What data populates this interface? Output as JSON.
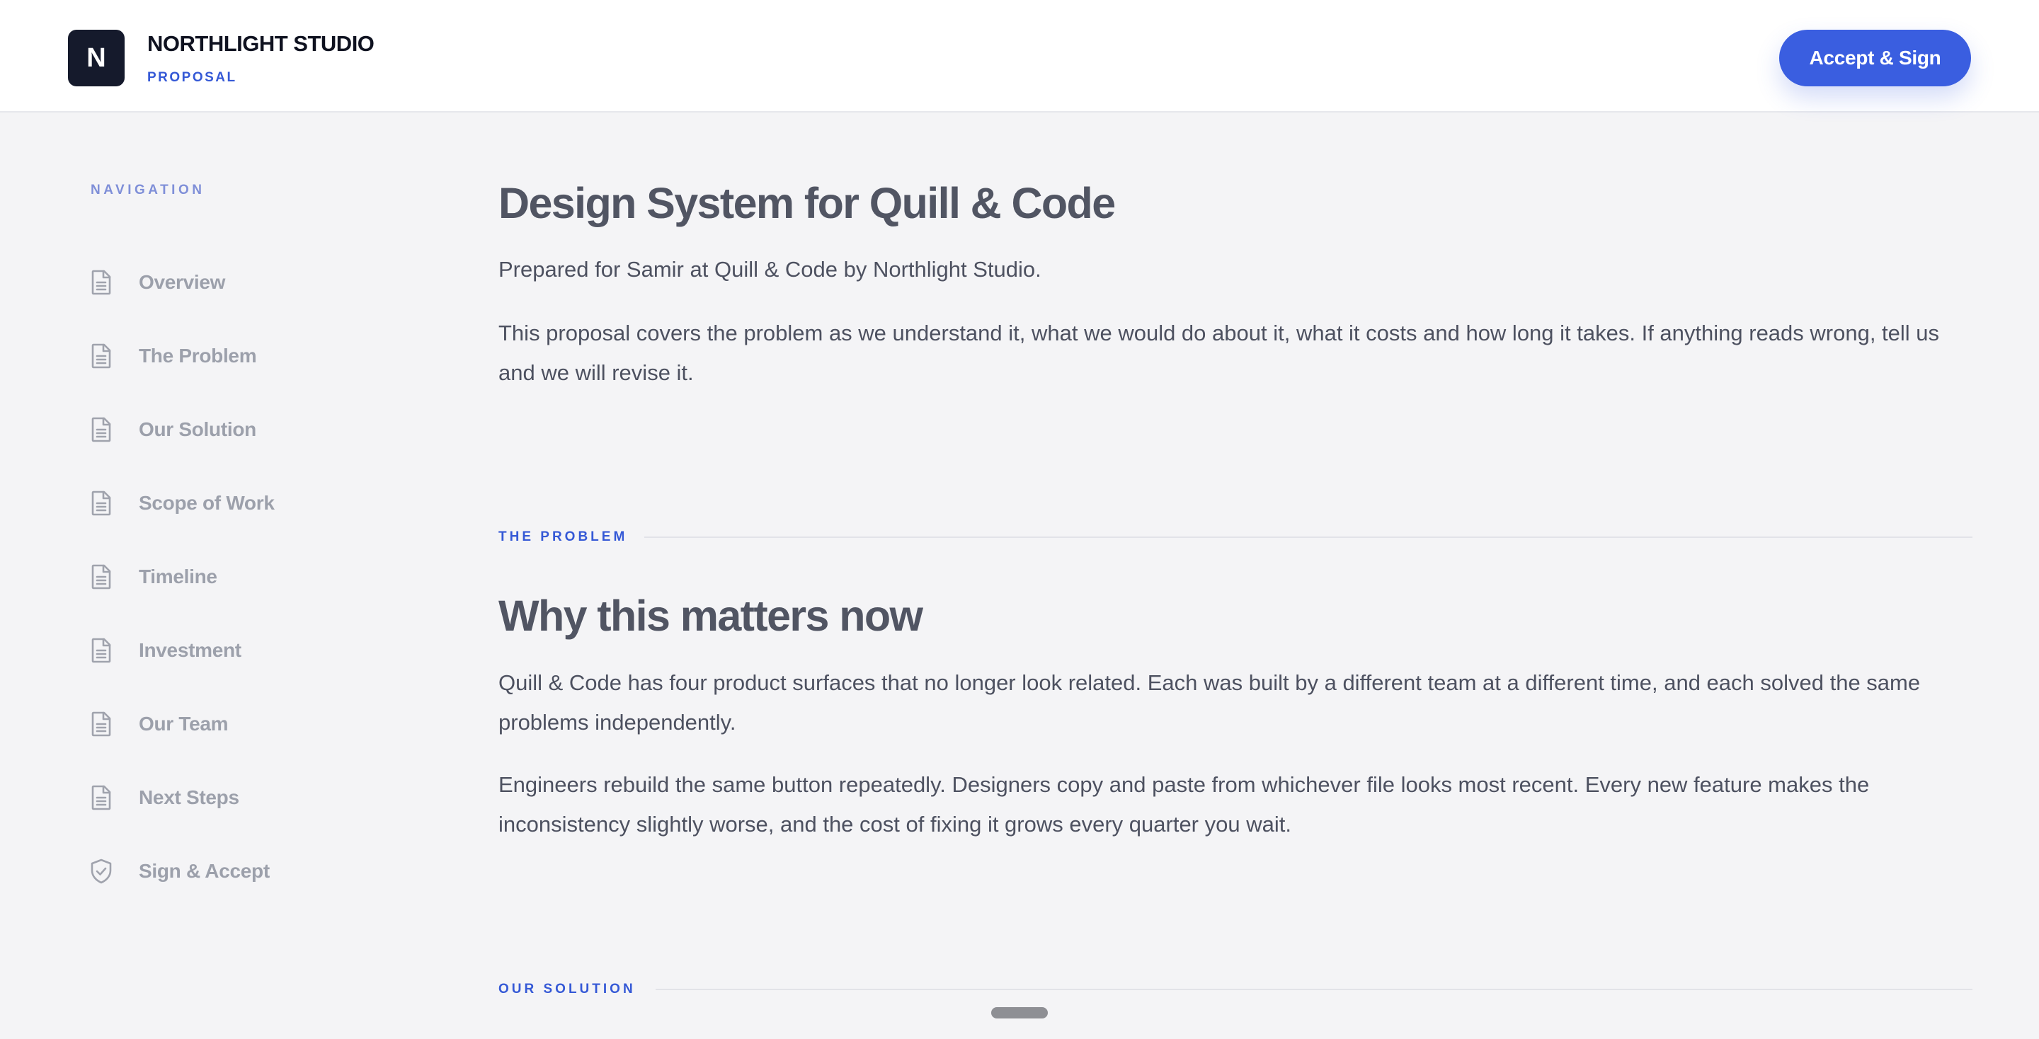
{
  "header": {
    "logo_letter": "N",
    "brand_name": "NORTHLIGHT STUDIO",
    "brand_subtitle": "PROPOSAL",
    "accept_button": "Accept & Sign"
  },
  "sidebar": {
    "heading": "NAVIGATION",
    "items": [
      {
        "label": "Overview",
        "icon": "document-icon"
      },
      {
        "label": "The Problem",
        "icon": "document-icon"
      },
      {
        "label": "Our Solution",
        "icon": "document-icon"
      },
      {
        "label": "Scope of Work",
        "icon": "document-icon"
      },
      {
        "label": "Timeline",
        "icon": "document-icon"
      },
      {
        "label": "Investment",
        "icon": "document-icon"
      },
      {
        "label": "Our Team",
        "icon": "document-icon"
      },
      {
        "label": "Next Steps",
        "icon": "document-icon"
      },
      {
        "label": "Sign & Accept",
        "icon": "shield-check-icon"
      }
    ]
  },
  "main": {
    "title": "Design System for Quill & Code",
    "prepared_for": "Prepared for Samir at Quill & Code by Northlight Studio.",
    "intro": "This proposal covers the problem as we understand it, what we would do about it, what it costs and how long it takes. If anything reads wrong, tell us and we will revise it.",
    "problem": {
      "label": "THE PROBLEM",
      "heading": "Why this matters now",
      "paragraphs": [
        "Quill & Code has four product surfaces that no longer look related. Each was built by a different team at a different time, and each solved the same problems independently.",
        "Engineers rebuild the same button repeatedly. Designers copy and paste from whichever file looks most recent. Every new feature makes the inconsistency slightly worse, and the cost of fixing it grows every quarter you wait."
      ]
    },
    "solution": {
      "label": "OUR SOLUTION"
    }
  },
  "colors": {
    "accent": "#3a5ee0",
    "logo_bg": "#151a2c",
    "page_bg": "#f4f4f6",
    "nav_text": "#9ca0ab"
  }
}
